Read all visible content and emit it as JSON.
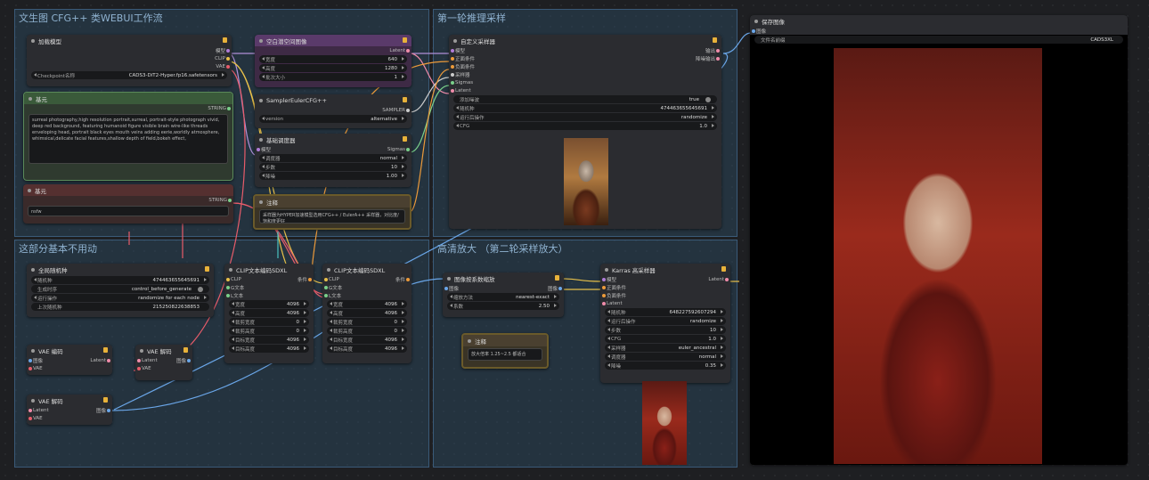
{
  "groups": {
    "main": "文生图 CFG++ 类WEBUI工作流",
    "sampler1": "第一轮推理采样",
    "unused": "这部分基本不用动",
    "hires": "高清放大 （第二轮采样放大）"
  },
  "load_model": {
    "title": "加载模型",
    "outputs": [
      "模型",
      "CLIP",
      "VAE"
    ],
    "ckpt_label": "Checkpoint名称",
    "ckpt_value": "CADS3-DiT2-Hyper.fp16.safetensors"
  },
  "empty_latent": {
    "title": "空白潜空间图像",
    "output": "Latent",
    "width_label": "宽度",
    "width_value": "640",
    "height_label": "高度",
    "height_value": "1280",
    "batch_label": "批次大小",
    "batch_value": "1"
  },
  "sampler_euler": {
    "title": "SamplerEulerCFG++",
    "output": "SAMPLER",
    "version_label": "version",
    "version_value": "alternative"
  },
  "basic_scheduler": {
    "title": "基础调度器",
    "input": "模型",
    "output": "Sigmas",
    "scheduler_label": "调度器",
    "scheduler_value": "normal",
    "steps_label": "步数",
    "steps_value": "10",
    "denoise_label": "降噪",
    "denoise_value": "1.00"
  },
  "prompt_pos": {
    "title": "基元",
    "output": "STRING",
    "text": "surreal photography,high resolution portrait,surreal, portrait-style photograph vivid, deep red background, featuring humanoid figure visible brain wire-like threads enveloping head, portrait black eyes mouth veins adding eerie,worldly atmosphere, whimsical,delicate facial features,shallow depth of field,bokeh effect,"
  },
  "prompt_neg": {
    "title": "基元",
    "output": "STRING",
    "text": "nsfw"
  },
  "note1": {
    "title": "注释",
    "text": "采样器为HYPER加速模型选用CFG++ / EulerA++ 采样器，对比度/饱和度更好"
  },
  "custom_sampler": {
    "title": "自定义采样器",
    "inputs": [
      "模型",
      "正面条件",
      "负面条件",
      "采样器",
      "Sigmas",
      "Latent"
    ],
    "outputs": [
      "输出",
      "降噪输出"
    ],
    "add_noise_label": "添加噪波",
    "add_noise_value": "true",
    "seed_label": "随机种",
    "seed_value": "474463655645691",
    "control_label": "运行后操作",
    "control_value": "randomize",
    "cfg_label": "CFG",
    "cfg_value": "1.0"
  },
  "global_seed": {
    "title": "全局随机种",
    "seed_label": "随机种",
    "seed_value": "474463655645691",
    "order_label": "生成时序",
    "order_value": "control_before_generate",
    "action_label": "运行操作",
    "action_value": "randomize for each node",
    "last_label": "上次随机种",
    "last_value": "215250822638853"
  },
  "vae_encode": {
    "title": "VAE 编码",
    "inputs": [
      "图像",
      "VAE"
    ],
    "output": "Latent"
  },
  "vae_decode1": {
    "title": "VAE 解码",
    "inputs": [
      "Latent",
      "VAE"
    ],
    "output": "图像"
  },
  "vae_decode2": {
    "title": "VAE 解码",
    "inputs": [
      "Latent",
      "VAE"
    ],
    "output": "图像"
  },
  "clip_a": {
    "title": "CLIP文本编码SDXL",
    "inputs": [
      "CLIP",
      "G文本",
      "L文本"
    ],
    "output": "条件",
    "fields": [
      {
        "label": "宽度",
        "value": "4096"
      },
      {
        "label": "高度",
        "value": "4096"
      },
      {
        "label": "裁剪宽度",
        "value": "0"
      },
      {
        "label": "裁剪高度",
        "value": "0"
      },
      {
        "label": "目标宽度",
        "value": "4096"
      },
      {
        "label": "目标高度",
        "value": "4096"
      }
    ]
  },
  "clip_b": {
    "title": "CLIP文本编码SDXL",
    "inputs": [
      "CLIP",
      "G文本",
      "L文本"
    ],
    "output": "条件",
    "fields": [
      {
        "label": "宽度",
        "value": "4096"
      },
      {
        "label": "高度",
        "value": "4096"
      },
      {
        "label": "裁剪宽度",
        "value": "0"
      },
      {
        "label": "裁剪高度",
        "value": "0"
      },
      {
        "label": "目标宽度",
        "value": "4096"
      },
      {
        "label": "目标高度",
        "value": "4096"
      }
    ]
  },
  "upscale": {
    "title": "图像按系数缩放",
    "input": "图像",
    "output": "图像",
    "method_label": "缩放方法",
    "method_value": "nearest-exact",
    "factor_label": "系数",
    "factor_value": "2.50"
  },
  "note2": {
    "title": "注释",
    "text": "放大倍率 1.25~2.5 都适合"
  },
  "karras": {
    "title": "Karras 高采样器",
    "inputs": [
      "模型",
      "正面条件",
      "负面条件",
      "Latent"
    ],
    "output": "Latent",
    "fields": [
      {
        "label": "随机种",
        "value": "648227592607294"
      },
      {
        "label": "运行后操作",
        "value": "randomize"
      },
      {
        "label": "步数",
        "value": "10"
      },
      {
        "label": "CFG",
        "value": "1.0"
      },
      {
        "label": "采样器",
        "value": "euler_ancestral"
      },
      {
        "label": "调度器",
        "value": "normal"
      },
      {
        "label": "降噪",
        "value": "0.35"
      }
    ]
  },
  "save_image": {
    "title": "保存图像",
    "input": "图像",
    "prefix_label": "文件名前缀",
    "prefix_value": "CADS3XL"
  }
}
